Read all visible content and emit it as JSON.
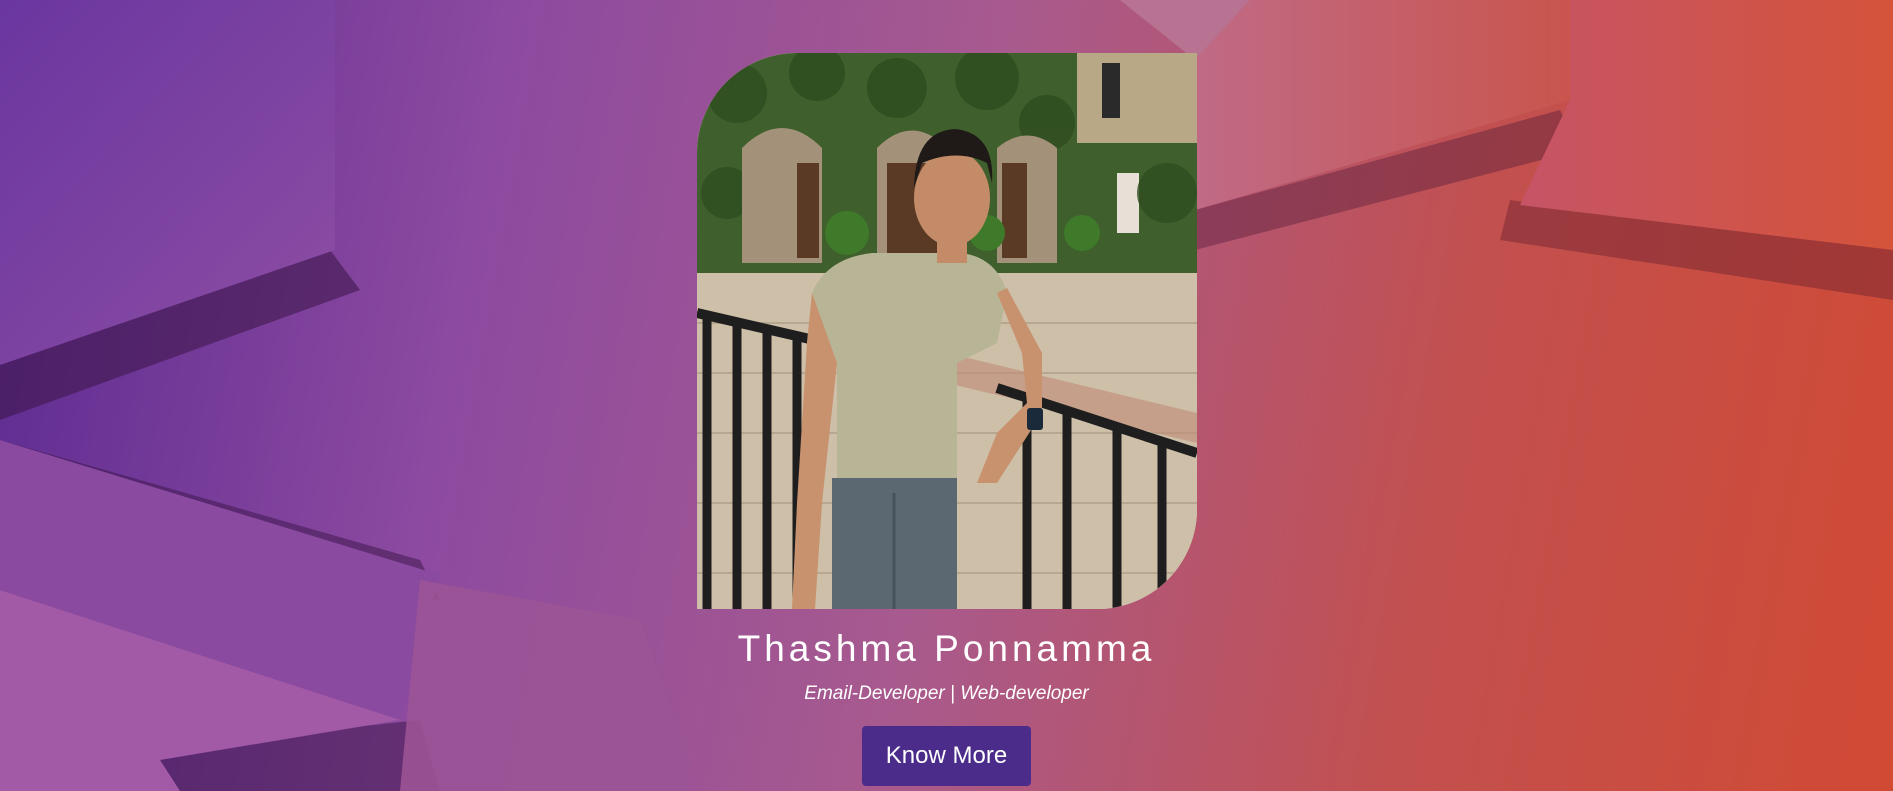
{
  "profile": {
    "name": "Thashma Ponnamma",
    "role": "Email-Developer | Web-developer",
    "photo_icon": "profile-photo"
  },
  "cta": {
    "label": "Know More"
  },
  "colors": {
    "background_start": "#5b2a91",
    "background_end": "#d14a34",
    "button": "#4b2c8a",
    "text": "#ffffff"
  }
}
